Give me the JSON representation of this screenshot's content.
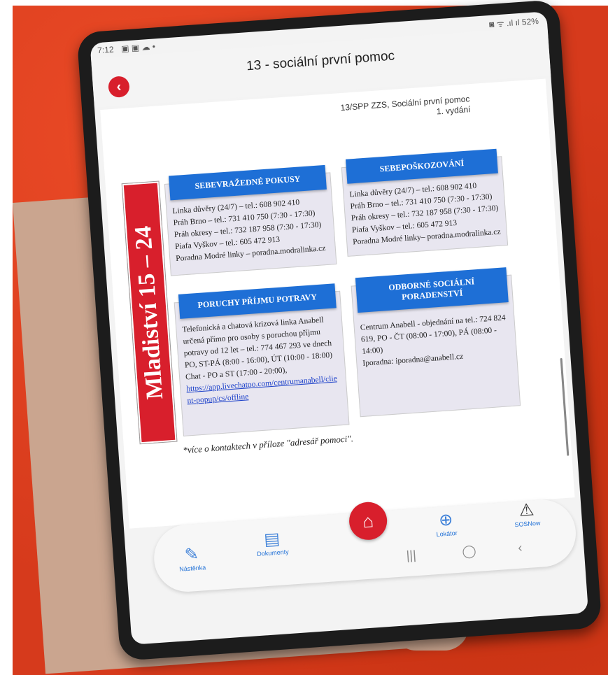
{
  "status_bar": {
    "time": "7:12",
    "icons_left": "▣ ▣ ☁ •",
    "battery": "52%",
    "icons_right": "◙ ᯤ .ıl ıl"
  },
  "header": {
    "title": "13 - sociální první pomoc",
    "back_icon": "chevron-left-icon"
  },
  "document": {
    "reference_line1": "13/SPP ZZS, Sociální první pomoc",
    "reference_line2": "1. vydání",
    "sidebar_label": "Mladiství  15 – 24",
    "boxes": [
      {
        "heading": "SEBEVRAŽEDNÉ POKUSY",
        "lines": [
          "Linka důvěry (24/7) – tel.: 608 902 410",
          "Práh Brno – tel.: 731 410 750 (7:30 - 17:30)",
          "Práh okresy – tel.: 732 187 958 (7:30 - 17:30)",
          "Piafa Vyškov – tel.: 605 472 913",
          "Poradna Modré linky – poradna.modralinka.cz"
        ]
      },
      {
        "heading": "SEBEPOŠKOZOVÁNÍ",
        "lines": [
          "Linka důvěry (24/7) – tel.: 608 902 410",
          "Práh Brno – tel.: 731 410 750 (7:30 - 17:30)",
          "Práh okresy – tel.: 732 187 958 (7:30 - 17:30)",
          "Piafa Vyškov – tel.: 605 472 913",
          "Poradna Modré linky– poradna.modralinka.cz"
        ]
      },
      {
        "heading": "PORUCHY PŘÍJMU POTRAVY",
        "lines": [
          "Telefonická a chatová krizová linka Anabell",
          "určená přímo pro osoby s poruchou příjmu",
          "potravy od 12 let – tel.: 774 467 293 ve dnech",
          "PO, ST-PÁ (8:00 - 16:00), ÚT (10:00 - 18:00)",
          "Chat - PO a ST (17:00 - 20:00),"
        ],
        "link": "https://app.livechatoo.com/centrumanabell/client-popup/cs/offline"
      },
      {
        "heading": "ODBORNÉ SOCIÁLNÍ PORADENSTVÍ",
        "lines": [
          "Centrum Anabell - objednání na tel.: 724 824",
          "619, PO - ČT (08:00 - 17:00), PÁ (08:00 -",
          "14:00)",
          "Iporadna: iporadna@anabell.cz"
        ]
      }
    ],
    "footnote": "*více o kontaktech v příloze \"adresář pomoci\"."
  },
  "bottom_nav": {
    "items": [
      {
        "label": "Nástěnka",
        "icon": "pin-icon"
      },
      {
        "label": "Dokumenty",
        "icon": "clipboard-icon"
      },
      {
        "label": "",
        "icon": "home-icon"
      },
      {
        "label": "Lokátor",
        "icon": "crosshair-icon"
      },
      {
        "label": "SOSNow",
        "icon": "warning-icon"
      }
    ]
  },
  "system_nav": {
    "recents": "|||",
    "home": "◯",
    "back": "‹"
  },
  "colors": {
    "accent_red": "#d81f2c",
    "header_blue": "#1e6fd6",
    "background_red": "#d63a1c"
  }
}
